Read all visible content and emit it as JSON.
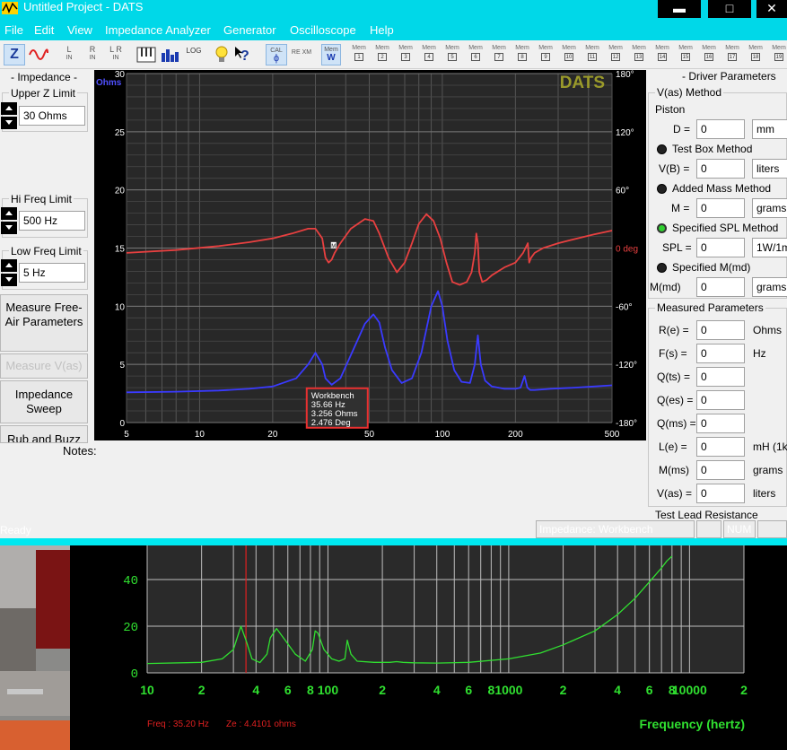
{
  "titlebar": {
    "title": "Untitled Project - DATS",
    "minimize": "▬",
    "maximize": "□",
    "close": "✕"
  },
  "menu": [
    "File",
    "Edit",
    "View",
    "Impedance Analyzer",
    "Generator",
    "Oscilloscope",
    "Help"
  ],
  "toolbar": {
    "z_label": "Z",
    "l_in": [
      "L",
      "IN"
    ],
    "r_in": [
      "R",
      "IN"
    ],
    "lr_in": [
      "L R",
      "IN"
    ],
    "log": "LOG",
    "cal": "CAL",
    "re_xm": "RE XM",
    "mem_label": "Mem",
    "mem_slots": [
      "W",
      "1",
      "2",
      "3",
      "4",
      "5",
      "6",
      "7",
      "8",
      "9",
      "10",
      "11",
      "12",
      "13",
      "14",
      "15",
      "16",
      "17",
      "18",
      "19"
    ]
  },
  "left_panel": {
    "title": "- Impedance -",
    "upper_z_label": "Upper Z Limit",
    "upper_z_value": "30 Ohms",
    "hi_freq_label": "Hi Freq Limit",
    "hi_freq_value": "500 Hz",
    "low_freq_label": "Low Freq Limit",
    "low_freq_value": "5 Hz",
    "btn_free_air": "Measure Free-Air Parameters",
    "btn_measure_vas": "Measure V(as)",
    "btn_sweep": "Impedance Sweep",
    "btn_rub": "Rub and Buzz"
  },
  "notes_label": "Notes:",
  "chart_data": [
    {
      "type": "line",
      "title": "DATS",
      "ylabel": "Ohms",
      "y2label": "deg",
      "x_scale": "log",
      "xlim": [
        5,
        500
      ],
      "ylim": [
        0,
        30
      ],
      "y2lim": [
        -180,
        180
      ],
      "x_ticks": [
        5,
        10,
        20,
        50,
        100,
        200,
        500
      ],
      "y_ticks": [
        0,
        5,
        10,
        15,
        20,
        25,
        30
      ],
      "y2_ticks": [
        -180,
        -120,
        -60,
        0,
        60,
        120,
        180
      ],
      "y2_tick_labels": [
        "-180°",
        "-120°",
        "-60°",
        "0 deg",
        "60°",
        "120°",
        "180°"
      ],
      "grid": true,
      "series": [
        {
          "color": "#3a3aff",
          "axis": "left",
          "x": [
            5,
            8,
            12,
            16,
            20,
            25,
            28,
            30,
            32,
            33,
            35,
            38,
            42,
            48,
            52,
            55,
            58,
            62,
            68,
            75,
            82,
            90,
            96,
            100,
            105,
            112,
            120,
            130,
            136,
            140,
            144,
            150,
            160,
            180,
            200,
            210,
            218,
            224,
            230,
            240,
            280,
            350,
            420,
            500
          ],
          "y": [
            2.6,
            2.65,
            2.75,
            2.9,
            3.1,
            3.8,
            5.0,
            6.0,
            5.0,
            3.8,
            3.25,
            3.8,
            5.8,
            8.5,
            9.3,
            8.6,
            6.5,
            4.5,
            3.4,
            3.8,
            6.0,
            10.0,
            11.3,
            10.0,
            7.0,
            4.5,
            3.5,
            3.4,
            5.0,
            7.5,
            5.0,
            3.6,
            3.1,
            2.9,
            2.9,
            3.0,
            4.0,
            3.0,
            2.8,
            2.8,
            2.9,
            3.0,
            3.1,
            3.2
          ]
        },
        {
          "color": "#e84040",
          "axis": "right",
          "x": [
            5,
            8,
            12,
            16,
            20,
            24,
            28,
            30,
            32,
            33,
            34,
            35,
            36,
            38,
            42,
            48,
            52,
            55,
            60,
            65,
            70,
            75,
            80,
            86,
            92,
            98,
            104,
            110,
            118,
            126,
            132,
            136,
            138,
            140,
            142,
            146,
            152,
            160,
            180,
            200,
            215,
            225,
            228,
            232,
            240,
            260,
            300,
            360,
            420,
            500
          ],
          "y": [
            -5,
            -2,
            2,
            6,
            10,
            15,
            20,
            20,
            10,
            -10,
            -15,
            -12,
            -5,
            5,
            20,
            30,
            28,
            15,
            -10,
            -25,
            -15,
            5,
            25,
            35,
            28,
            10,
            -15,
            -35,
            -38,
            -35,
            -25,
            -5,
            15,
            5,
            -25,
            -35,
            -33,
            -28,
            -20,
            -15,
            -5,
            5,
            -15,
            -10,
            -5,
            0,
            5,
            10,
            14,
            18
          ]
        }
      ],
      "tooltip": {
        "lines": [
          "Workbench",
          "35.66 Hz",
          "3.256 Ohms",
          "2.476 Deg"
        ],
        "x": 35.66,
        "y": 3.256
      },
      "marker": {
        "label": "M",
        "x": 35.66,
        "y_deg": 2.476
      }
    },
    {
      "type": "line",
      "xlabel": "Frequency (hertz)",
      "x_scale": "log",
      "xlim": [
        10,
        20000
      ],
      "ylim": [
        0,
        50
      ],
      "y_ticks": [
        0,
        20,
        40
      ],
      "x_tick_labels": [
        {
          "v": 10,
          "t": "10"
        },
        {
          "v": 20,
          "t": "2"
        },
        {
          "v": 40,
          "t": "4"
        },
        {
          "v": 60,
          "t": "6"
        },
        {
          "v": 80,
          "t": "8"
        },
        {
          "v": 100,
          "t": "100"
        },
        {
          "v": 200,
          "t": "2"
        },
        {
          "v": 400,
          "t": "4"
        },
        {
          "v": 600,
          "t": "6"
        },
        {
          "v": 800,
          "t": "8"
        },
        {
          "v": 1000,
          "t": "1000"
        },
        {
          "v": 2000,
          "t": "2"
        },
        {
          "v": 4000,
          "t": "4"
        },
        {
          "v": 6000,
          "t": "6"
        },
        {
          "v": 8000,
          "t": "8"
        },
        {
          "v": 10000,
          "t": "10000"
        },
        {
          "v": 20000,
          "t": "2"
        }
      ],
      "cursor_x": 35.2,
      "series": [
        {
          "color": "#30e030",
          "x": [
            10,
            20,
            26,
            30,
            33,
            35.2,
            38,
            42,
            46,
            48,
            52,
            58,
            66,
            75,
            82,
            85,
            88,
            95,
            105,
            115,
            124,
            128,
            134,
            145,
            180,
            220,
            240,
            260,
            300,
            400,
            600,
            1000,
            1500,
            2000,
            3000,
            4000,
            5000,
            6000,
            7000,
            7500,
            8000
          ],
          "y": [
            4,
            4.5,
            6,
            10,
            20,
            14,
            6,
            4.4,
            8,
            15,
            19,
            14,
            8,
            5,
            10,
            18,
            17,
            10,
            6,
            5,
            6,
            14,
            8,
            5,
            4.5,
            4.5,
            4.8,
            4.5,
            4.3,
            4.2,
            4.5,
            6,
            8.5,
            12,
            18,
            25,
            32,
            39,
            45,
            48,
            50
          ]
        }
      ]
    }
  ],
  "right_panel": {
    "title": "- Driver Parameters",
    "vas_method": "V(as) Method",
    "piston": "Piston",
    "d_label": "D =",
    "d_value": "0",
    "d_unit": "mm",
    "test_box": "Test Box Method",
    "vb_label": "V(B) =",
    "vb_value": "0",
    "vb_unit": "liters",
    "added_mass": "Added Mass Method",
    "m_label": "M =",
    "m_value": "0",
    "m_unit": "grams",
    "spl_method": "Specified SPL Method",
    "spl_label": "SPL =",
    "spl_value": "0",
    "spl_unit": "1W/1m",
    "mmd_method": "Specified M(md)",
    "mmd_label": "M(md)",
    "mmd_value": "0",
    "mmd_unit": "grams",
    "measured": "Measured Parameters",
    "params": [
      {
        "label": "R(e) =",
        "value": "0",
        "unit": "Ohms"
      },
      {
        "label": "F(s) =",
        "value": "0",
        "unit": "Hz"
      },
      {
        "label": "Q(ts) =",
        "value": "0",
        "unit": ""
      },
      {
        "label": "Q(es) =",
        "value": "0",
        "unit": ""
      },
      {
        "label": "Q(ms) =",
        "value": "0",
        "unit": ""
      },
      {
        "label": "L(e) =",
        "value": "0",
        "unit": "mH (1k"
      },
      {
        "label": "M(ms)",
        "value": "0",
        "unit": "grams"
      },
      {
        "label": "V(as) =",
        "value": "0",
        "unit": "liters"
      }
    ],
    "test_lead": "Test Lead Resistance"
  },
  "statusbar": {
    "ready": "Ready",
    "mode": "Impedance: Workbench",
    "num": "NUM"
  },
  "bottom": {
    "readout_freq": "Freq : 35.20 Hz",
    "readout_ze": "Ze : 4.4101 ohms"
  },
  "colors": {
    "titlebar": "#00d8e8",
    "chart_bg": "#282828",
    "impedance": "#3a3aff",
    "phase": "#e84040",
    "scope_green": "#30e030"
  }
}
